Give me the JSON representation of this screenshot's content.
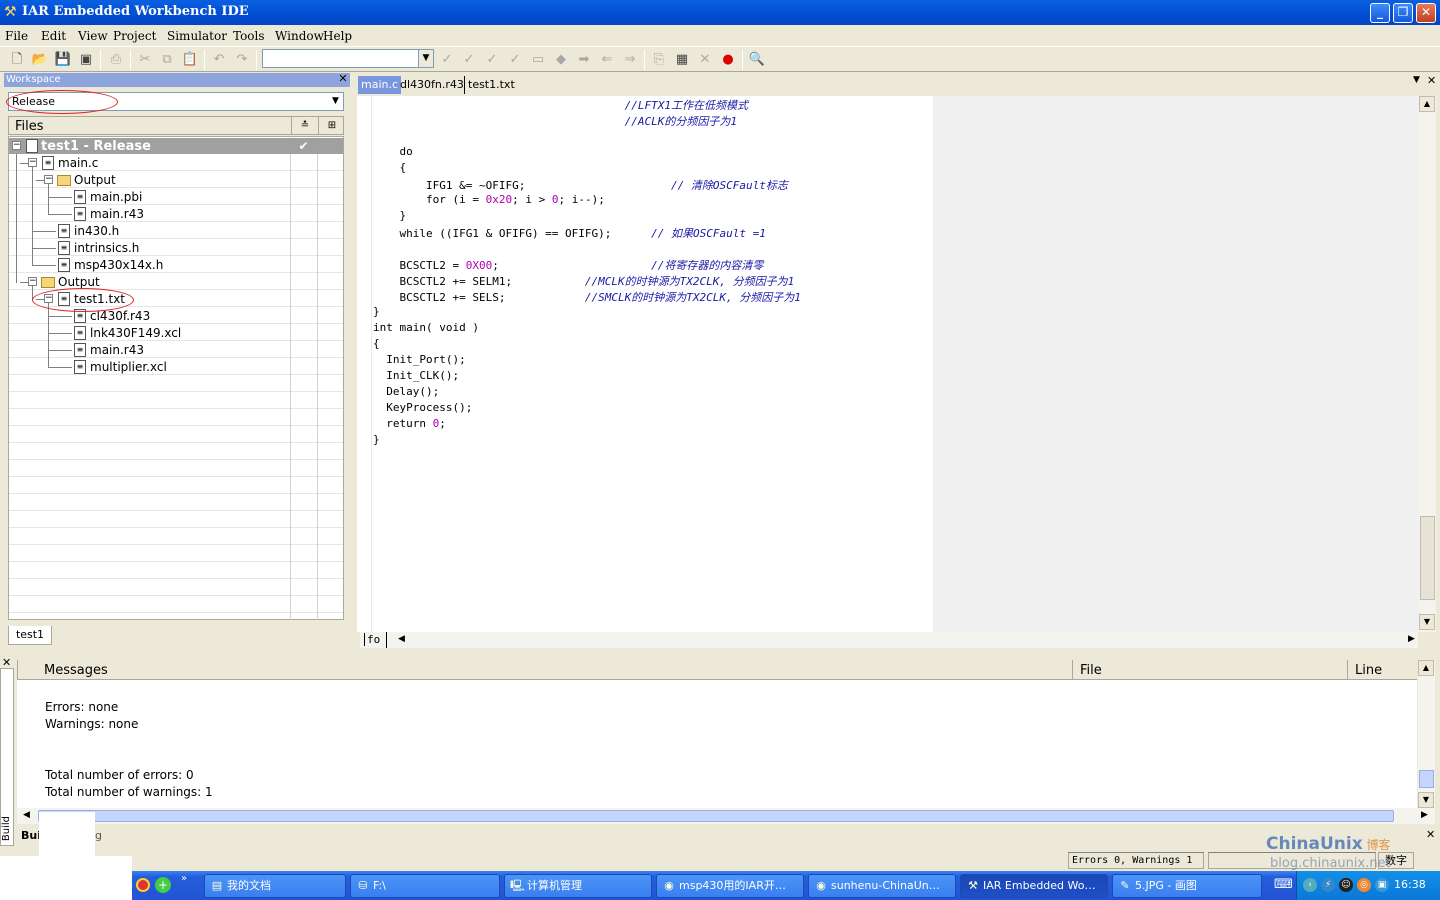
{
  "window": {
    "title": "IAR Embedded Workbench IDE",
    "controls": [
      "minimize",
      "restore",
      "close"
    ]
  },
  "menu": [
    "File",
    "Edit",
    "View",
    "Project",
    "Simulator",
    "Tools",
    "Window",
    "Help"
  ],
  "toolbar": {
    "combo_value": "",
    "buttons": [
      "new-file",
      "open",
      "save",
      "save-all",
      "print",
      "cut",
      "copy",
      "paste",
      "undo",
      "redo",
      "find",
      "find-next",
      "replace",
      "goto",
      "bookmark",
      "prev-bookmark",
      "next-bookmark",
      "compile",
      "make",
      "stop-build",
      "toggle-breakpoint",
      "debug"
    ]
  },
  "workspace": {
    "title": "Workspace",
    "configuration": "Release",
    "files_header": "Files",
    "root": "test1 - Release",
    "tree": [
      {
        "label": "main.c",
        "type": "file",
        "level": 1
      },
      {
        "label": "Output",
        "type": "folder",
        "level": 2
      },
      {
        "label": "main.pbi",
        "type": "file",
        "level": 3
      },
      {
        "label": "main.r43",
        "type": "file",
        "level": 3
      },
      {
        "label": "in430.h",
        "type": "file",
        "level": 1
      },
      {
        "label": "intrinsics.h",
        "type": "file",
        "level": 1
      },
      {
        "label": "msp430x14x.h",
        "type": "file",
        "level": 1
      },
      {
        "label": "Output",
        "type": "folder",
        "level": 1
      },
      {
        "label": "test1.txt",
        "type": "file",
        "level": 2
      },
      {
        "label": "cl430f.r43",
        "type": "file",
        "level": 3
      },
      {
        "label": "lnk430F149.xcl",
        "type": "file",
        "level": 3
      },
      {
        "label": "main.r43",
        "type": "file",
        "level": 3
      },
      {
        "label": "multiplier.xcl",
        "type": "file",
        "level": 3
      }
    ],
    "tab": "test1"
  },
  "editor": {
    "tabs": [
      "main.c",
      "dl430fn.r43",
      "test1.txt"
    ],
    "active_tab": "main.c",
    "gutter_label": "fo",
    "code": [
      {
        "code": "                                      ",
        "comment": "//LFTX1工作在低频模式"
      },
      {
        "code": "                                      ",
        "comment": "//ACLK的分频因子为1"
      },
      {
        "code": "",
        "comment": ""
      },
      {
        "code": "    do",
        "comment": ""
      },
      {
        "code": "    {",
        "comment": ""
      },
      {
        "code": "        IFG1 &= ~OFIFG;                      ",
        "comment": "// 清除OSCFault标志"
      },
      {
        "code": "        for (i = 0x20; i > 0; i--);",
        "comment": ""
      },
      {
        "code": "    }",
        "comment": ""
      },
      {
        "code": "    while ((IFG1 & OFIFG) == OFIFG);      ",
        "comment": "// 如果OSCFault =1"
      },
      {
        "code": "",
        "comment": ""
      },
      {
        "code": "    BCSCTL2 = 0X00;                       ",
        "comment": "//将寄存器的内容清零"
      },
      {
        "code": "    BCSCTL2 += SELM1;           ",
        "comment": "//MCLK的时钟源为TX2CLK, 分频因子为1"
      },
      {
        "code": "    BCSCTL2 += SELS;            ",
        "comment": "//SMCLK的时钟源为TX2CLK, 分频因子为1"
      },
      {
        "code": "}",
        "comment": ""
      },
      {
        "code": "int main( void )",
        "comment": ""
      },
      {
        "code": "{",
        "comment": ""
      },
      {
        "code": "  Init_Port();",
        "comment": ""
      },
      {
        "code": "  Init_CLK();",
        "comment": ""
      },
      {
        "code": "  Delay();",
        "comment": ""
      },
      {
        "code": "  KeyProcess();",
        "comment": ""
      },
      {
        "code": "  return 0;",
        "comment": ""
      },
      {
        "code": "}",
        "comment": ""
      }
    ]
  },
  "messages": {
    "columns": [
      "Messages",
      "File",
      "Line"
    ],
    "lines": [
      "Errors: none",
      "Warnings: none",
      "",
      "",
      "Total number of errors: 0",
      "Total number of warnings: 1"
    ],
    "tabs": [
      "Build",
      "Debug Log"
    ],
    "tab_visible": [
      "Buil",
      "g"
    ],
    "side_tab": "Build"
  },
  "status": {
    "errors": "Errors 0, Warnings 1",
    "num": "数字"
  },
  "watermark": {
    "name": "ChinaUnix",
    "suffix": "博客",
    "url": "blog.chinaunix.net"
  },
  "taskbar": {
    "items": [
      {
        "label": "我的文档",
        "icon": "folder-icon"
      },
      {
        "label": "F:\\",
        "icon": "drive-icon"
      },
      {
        "label": "计算机管理",
        "icon": "computer-icon"
      },
      {
        "label": "msp430用的IAR开…",
        "icon": "browser-icon"
      },
      {
        "label": "sunhenu-ChinaUn…",
        "icon": "browser-icon"
      },
      {
        "label": "IAR Embedded Wo…",
        "icon": "iar-icon"
      },
      {
        "label": "5.JPG - 画图",
        "icon": "paint-icon"
      }
    ],
    "active": "IAR Embedded Wo…",
    "clock": "16:38"
  }
}
